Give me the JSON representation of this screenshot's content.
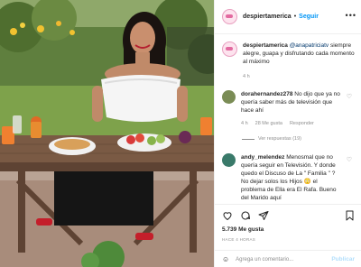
{
  "post": {
    "username": "despiertamerica",
    "follow_label": "Seguir",
    "more_label": "•••"
  },
  "caption": {
    "username": "despiertamerica",
    "mention": "@anapatriciatv",
    "text": "siempre alegre, guapa y disfrutando cada momento al máximo",
    "time": "4 h"
  },
  "comments": [
    {
      "username": "dorahernandez278",
      "text": "No dijo que ya no quería saber más de televisión que hace ahí",
      "time": "4 h",
      "likes": "28 Me gusta",
      "reply_label": "Responder",
      "view_replies": "Ver respuestas (19)"
    },
    {
      "username": "andy_melendez",
      "text": "Menosmal que no quería seguir en Televisión. Y donde quedo el Discuso de La \" Familia \" ? No dejar solos los Hijos 😳 el problema de Ella era El Rafa. Bueno del Marido aquí"
    }
  ],
  "stats": {
    "likes": "5.739 Me gusta",
    "time": "HACE 4 HORAS"
  },
  "add_comment": {
    "placeholder": "Agrega un comentario...",
    "publish_label": "Publicar"
  },
  "icons": {
    "heart": "heart-icon",
    "comment": "comment-icon",
    "share": "share-icon",
    "save": "bookmark-icon",
    "emoji": "emoji-icon"
  },
  "colors": {
    "link": "#0095f6",
    "muted": "#8e8e8e",
    "publish_disabled": "#b2dffc"
  }
}
